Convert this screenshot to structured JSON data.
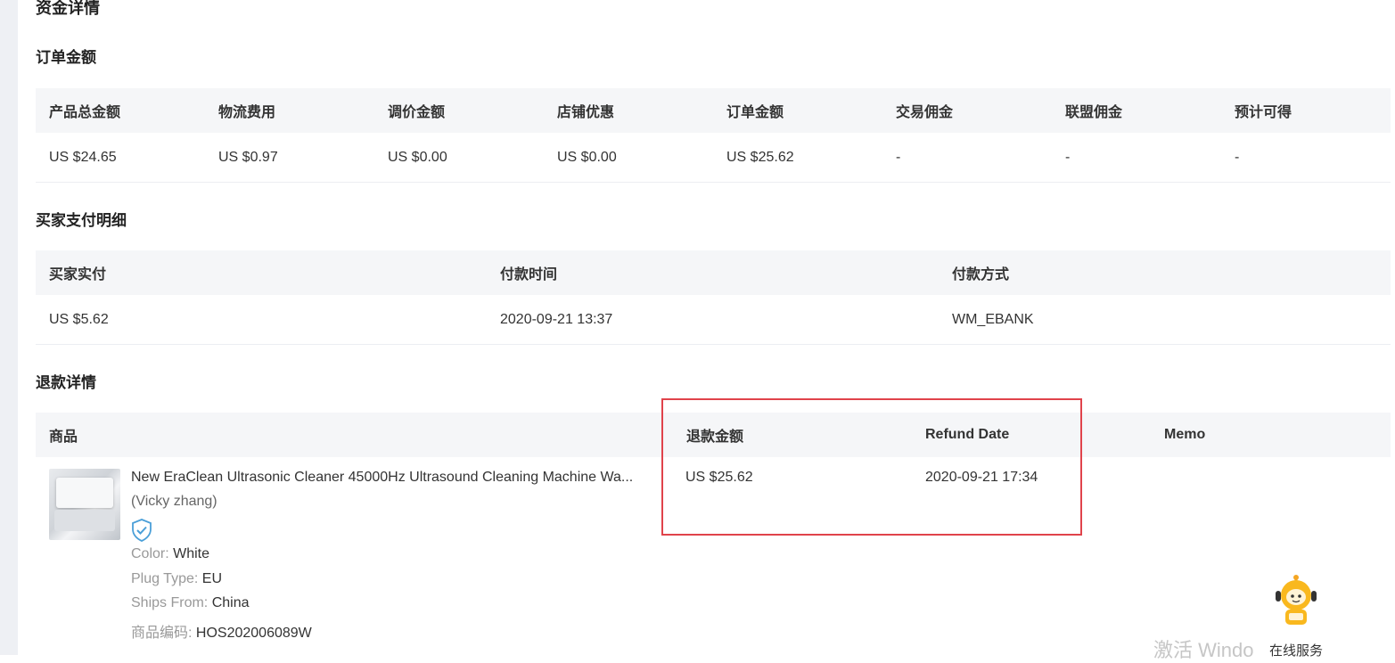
{
  "page_title": "资金详情",
  "order_amount": {
    "title": "订单金额",
    "headers": [
      "产品总金额",
      "物流费用",
      "调价金额",
      "店铺优惠",
      "订单金额",
      "交易佣金",
      "联盟佣金",
      "预计可得"
    ],
    "values": [
      "US $24.65",
      "US $0.97",
      "US $0.00",
      "US $0.00",
      "US $25.62",
      "-",
      "-",
      "-"
    ]
  },
  "buyer_payment": {
    "title": "买家支付明细",
    "headers": [
      "买家实付",
      "付款时间",
      "付款方式"
    ],
    "values": [
      "US $5.62",
      "2020-09-21 13:37",
      "WM_EBANK"
    ]
  },
  "refund": {
    "title": "退款详情",
    "headers": [
      "商品",
      "退款金额",
      "Refund Date",
      "Memo"
    ],
    "product": {
      "title": "New EraClean Ultrasonic Cleaner 45000Hz Ultrasound Cleaning Machine Wa...",
      "seller": "(Vicky zhang)",
      "attributes": [
        {
          "key": "Color: ",
          "value": "White"
        },
        {
          "key": "Plug Type: ",
          "value": "EU"
        },
        {
          "key": "Ships From: ",
          "value": "China"
        },
        {
          "key": "商品编码: ",
          "value": "HOS202006089W"
        }
      ]
    },
    "amount": "US $25.62",
    "date": "2020-09-21 17:34",
    "memo": ""
  },
  "highlight_color": "#e0434b",
  "support": {
    "label": "在线服务",
    "icon": "robot-mascot-icon"
  },
  "watermark": "激活 Windo"
}
